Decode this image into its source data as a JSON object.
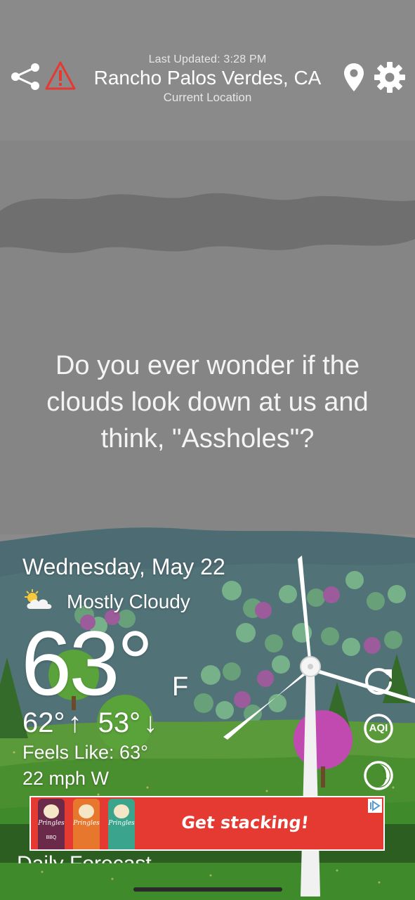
{
  "header": {
    "last_updated": "Last Updated: 3:28 PM",
    "location": "Rancho Palos Verdes, CA",
    "sublocation": "Current Location",
    "icons": [
      "share-icon",
      "alert-icon",
      "location-pin-icon",
      "settings-gear-icon"
    ],
    "alert_color": "#e53a32"
  },
  "quote": {
    "line1": "Do you ever wonder if the",
    "line2": "clouds look down at us and",
    "line3": "think, \"Assholes\"?"
  },
  "weather": {
    "date": "Wednesday, May 22",
    "condition": "Mostly Cloudy",
    "condition_icon": "partly-cloudy-icon",
    "temperature": "63°",
    "unit": "F",
    "high": "62°",
    "high_arrow": "↑",
    "low": "53°",
    "low_arrow": "↓",
    "feels_like": "Feels Like: 63°",
    "wind": "22 mph W"
  },
  "side_buttons": {
    "refresh": "refresh-icon",
    "aqi": "AQI",
    "moon": "moon-phase-icon"
  },
  "ad": {
    "headline": "Get stacking!",
    "cans": [
      {
        "brand": "Pringles",
        "flavor": "BBQ",
        "color": "#6b2a4a"
      },
      {
        "brand": "Pringles",
        "flavor": "",
        "color": "#e8772e"
      },
      {
        "brand": "Pringles",
        "flavor": "",
        "color": "#3aa58c"
      }
    ],
    "badge_icon": "adchoices-icon",
    "background": "#e53a32"
  },
  "section": {
    "daily_forecast": "Daily Forecast"
  },
  "colors": {
    "sky": "#8a8a8a",
    "cloud_band": "#6f6f6f",
    "far_hills": "#4d6b72",
    "meadow": "#5a9a3a",
    "grass": "#3f8a2a"
  }
}
